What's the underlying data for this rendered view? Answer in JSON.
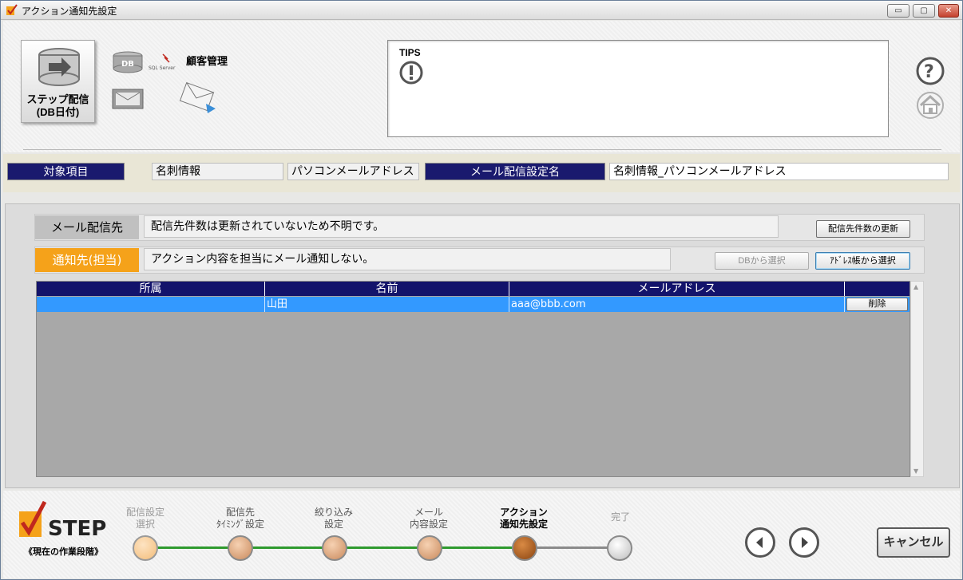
{
  "window": {
    "title": "アクション通知先設定",
    "controls": {
      "minimize": "▭",
      "maximize": "▢",
      "close": "✕"
    }
  },
  "header": {
    "step_button_label_line1": "ステップ配信",
    "step_button_label_line2": "(DB日付)",
    "db_label": "DB",
    "sql_label": "SQL Server",
    "kokyaku_label": "顧客管理",
    "tips_title": "TIPS",
    "icons": [
      "arrow-right-icon",
      "database-icon",
      "sql-server-icon",
      "mail-tray-icon",
      "mail-send-icon",
      "help-icon",
      "home-icon",
      "exclamation-icon"
    ]
  },
  "infobar": {
    "target_label": "対象項目",
    "target_value1": "名刺情報",
    "target_value2": "パソコンメールアドレス",
    "setting_name_label": "メール配信設定名",
    "setting_name_value": "名刺情報_パソコンメールアドレス"
  },
  "main": {
    "mail_dest_label": "メール配信先",
    "mail_dest_text": "配信先件数は更新されていないため不明です。",
    "update_count_button": "配信先件数の更新",
    "notify_label": "通知先(担当)",
    "notify_text": "アクション内容を担当にメール通知しない。",
    "db_select_button": "DBから選択",
    "address_book_button": "ｱﾄﾞﾚｽ帳から選択",
    "table": {
      "columns": [
        "所属",
        "名前",
        "メールアドレス",
        ""
      ],
      "rows": [
        {
          "affiliation": "",
          "name": "山田",
          "email": "aaa@bbb.com",
          "action": "削除"
        }
      ]
    }
  },
  "footer": {
    "step_logo_text": "STEP",
    "step_caption": "《現在の作業段階》",
    "steps": [
      {
        "line1": "配信設定",
        "line2": "選択"
      },
      {
        "line1": "配信先",
        "line2": "ﾀｲﾐﾝｸﾞ設定"
      },
      {
        "line1": "絞り込み",
        "line2": "設定"
      },
      {
        "line1": "メール",
        "line2": "内容設定"
      },
      {
        "line1": "アクション",
        "line2": "通知先設定"
      },
      {
        "line1": "完了",
        "line2": ""
      }
    ],
    "cancel_button": "キャンセル",
    "colors": {
      "accent_orange": "#f5a21a",
      "navy": "#13136b",
      "selection_blue": "#3399ff",
      "progress_green": "#2e9a2e"
    }
  }
}
